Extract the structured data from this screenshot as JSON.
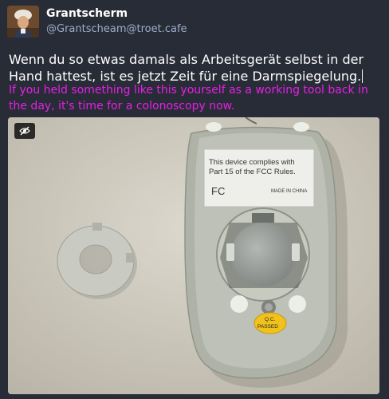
{
  "author": {
    "display_name": "Grantscherm",
    "handle": "@Grantscheam@troet.cafe",
    "avatar_icon": "avatar-portrait"
  },
  "post": {
    "text": "Wenn du so etwas damals als Arbeitsgerät selbst in der Hand hattest, ist es jetzt Zeit für eine Darmspiegelung.",
    "translation": "If you held something like this yourself as a working tool back in the day, it's time for a colonoscopy now.",
    "translation_color": "#e91ee8"
  },
  "media": {
    "hide_icon": "eye-slash-icon",
    "label_line1": "This device complies with",
    "label_line2": "Part 15 of the FCC Rules.",
    "label_fcc": "FC",
    "label_made_in": "MADE IN CHINA",
    "sticker_line1": "Q.C.",
    "sticker_line2": "PASSED"
  },
  "colors": {
    "background": "#282c37",
    "handle": "#9baec8"
  }
}
